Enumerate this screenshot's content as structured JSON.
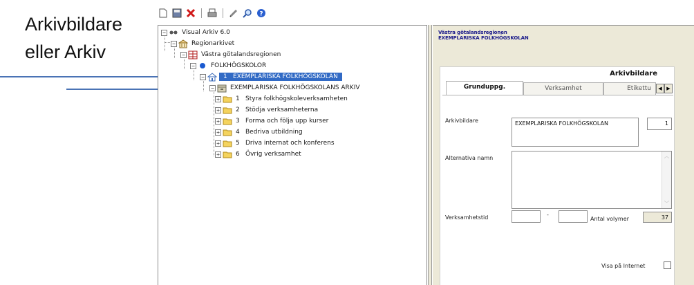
{
  "annotation": {
    "caption_line1": "Arkivbildare",
    "caption_line2": "eller Arkiv",
    "arrow_color": "#4a73b5"
  },
  "toolbar": {
    "buttons": [
      "new-document-icon",
      "save-icon",
      "delete-icon",
      "print-icon",
      "edit-icon",
      "search-icon",
      "help-icon"
    ]
  },
  "tree": {
    "root": "Visual Arkiv 6.0",
    "regionarkivet": "Regionarkivet",
    "region": "Västra götalandsregionen",
    "folkhogskolor": "FOLKHÖGSKOLOR",
    "school": {
      "number": "1",
      "name": "EXEMPLARISKA  FOLKHÖGSKOLAN"
    },
    "archive": "EXEMPLARISKA  FOLKHÖGSKOLANS  ARKIV",
    "series": [
      {
        "number": "1",
        "label": "Styra folkhögskoleverksamheten"
      },
      {
        "number": "2",
        "label": "Stödja verksamheterna"
      },
      {
        "number": "3",
        "label": "Forma och följa upp kurser"
      },
      {
        "number": "4",
        "label": "Bedriva utbildning"
      },
      {
        "number": "5",
        "label": "Driva internat och konferens"
      },
      {
        "number": "6",
        "label": "Övrig verksamhet"
      }
    ]
  },
  "detail": {
    "region_line": "Västra götalandsregionen",
    "school_line": "EXEMPLARISKA  FOLKHÖGSKOLAN",
    "form_title": "Arkivbildare",
    "tabs": [
      "Grunduppg.",
      "Verksamhet",
      "Etikettu"
    ],
    "fields": {
      "arkivbildare_label": "Arkivbildare",
      "arkivbildare_value": "EXEMPLARISKA  FOLKHÖGSKOLAN",
      "arkivbildare_number": "1",
      "alternativa_label": "Alternativa namn",
      "alternativa_value": "",
      "verksamhetstid_label": "Verksamhetstid",
      "verksamhetstid_from": "",
      "dash": "-",
      "verksamhetstid_to": "",
      "antal_label": "Antal volymer",
      "antal_value": "37",
      "visa_label": "Visa på Internet",
      "visa_checked": false
    }
  }
}
